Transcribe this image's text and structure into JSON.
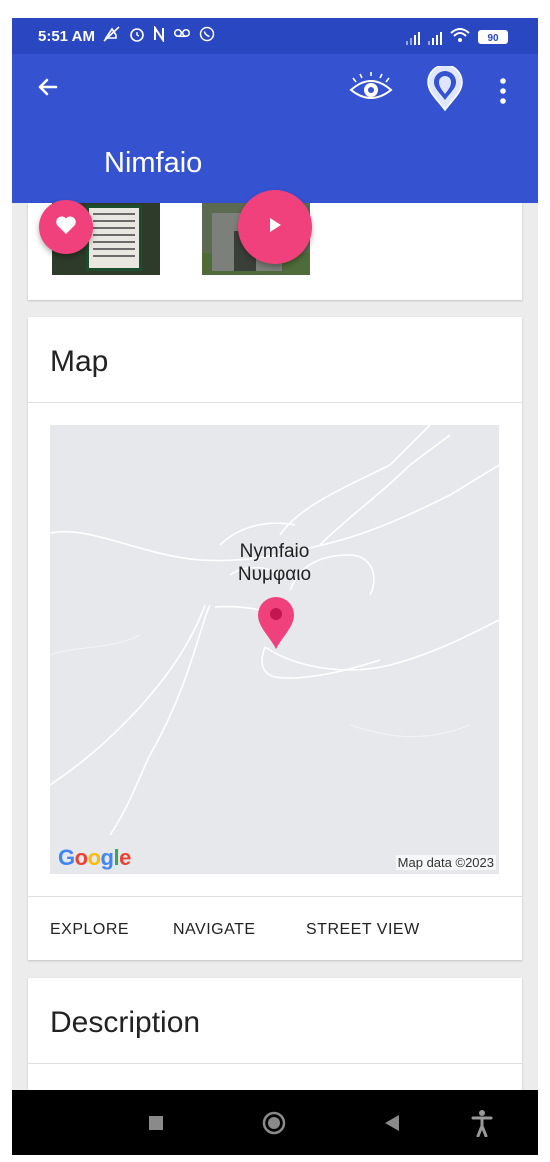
{
  "status_bar": {
    "time": "5:51 AM",
    "notification_icons": [
      "muted-icon",
      "alarm-icon",
      "n-icon",
      "voicemail-icon",
      "viber-icon"
    ],
    "battery": "90"
  },
  "app_bar": {
    "title": "Nimfaio",
    "actions": [
      "back-icon",
      "eye-icon",
      "place-icon",
      "more-icon"
    ],
    "color": "#3552d0"
  },
  "photos": {
    "favorite_icon": "heart-icon",
    "play_icon": "play-icon",
    "accent_color": "#f0417c"
  },
  "map_card": {
    "heading": "Map",
    "place_name_latin": "Nymfaio",
    "place_name_greek": "Νυμφαιο",
    "logo": "Google",
    "attribution": "Map data ©2023",
    "actions": [
      {
        "label": "EXPLORE"
      },
      {
        "label": "NAVIGATE"
      },
      {
        "label": "STREET VIEW"
      }
    ]
  },
  "description_card": {
    "heading": "Description"
  },
  "nav_bar": {
    "items": [
      "recents-square-icon",
      "home-circle-icon",
      "back-triangle-icon",
      "accessibility-icon"
    ]
  }
}
